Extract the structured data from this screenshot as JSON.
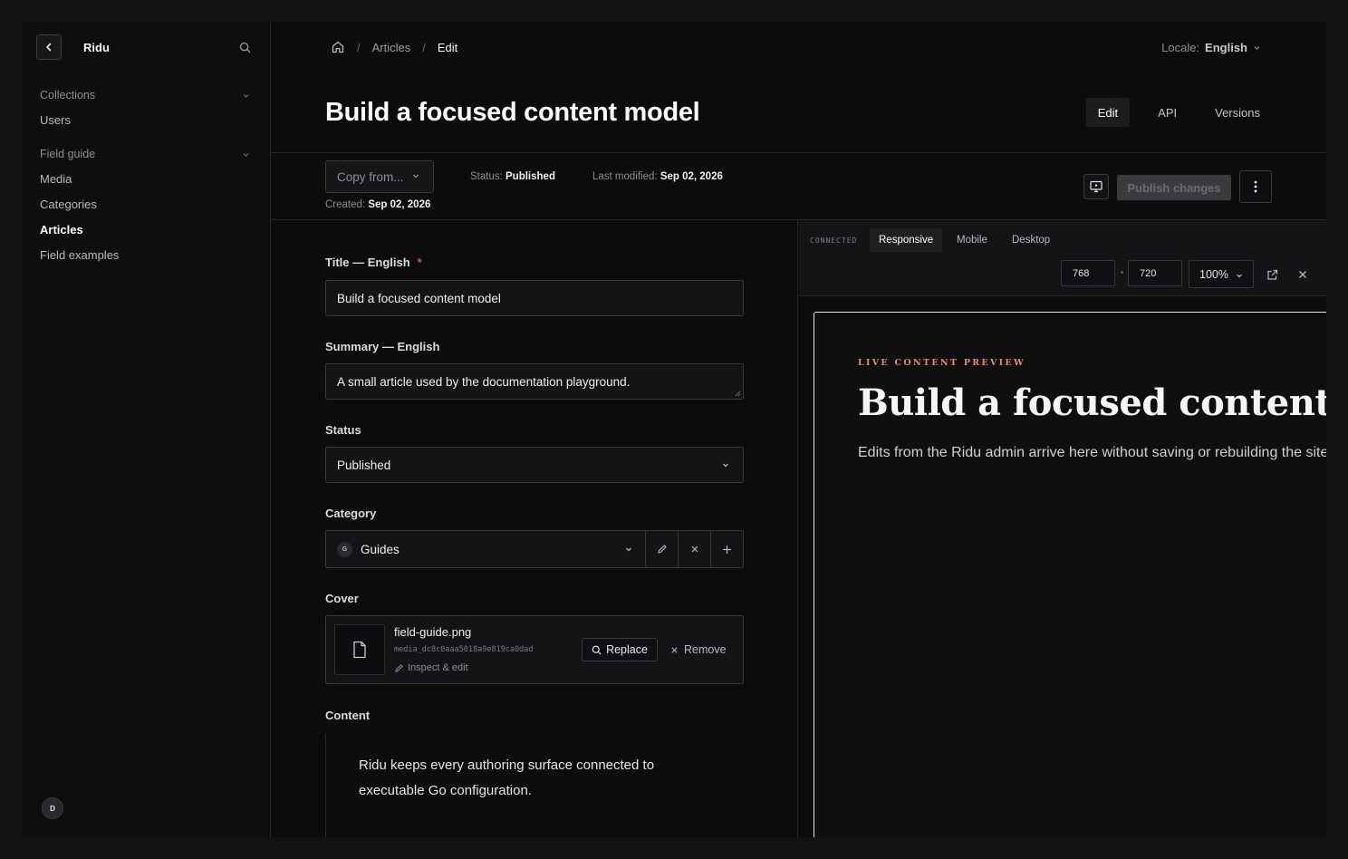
{
  "sidebar": {
    "brand": "Ridu",
    "groups": [
      {
        "label": "Collections",
        "items": [
          "Users"
        ]
      },
      {
        "label": "Field guide",
        "items": [
          "Media",
          "Categories",
          "Articles",
          "Field examples"
        ]
      }
    ],
    "active_item": "Articles",
    "avatar_initial": "D"
  },
  "breadcrumb": {
    "items": [
      "Articles",
      "Edit"
    ]
  },
  "locale": {
    "label": "Locale:",
    "value": "English"
  },
  "page": {
    "title": "Build a focused content model"
  },
  "tabs": [
    "Edit",
    "API",
    "Versions"
  ],
  "meta": {
    "copy_from_placeholder": "Copy from...",
    "status_label": "Status:",
    "status_value": "Published",
    "last_modified_label": "Last modified:",
    "last_modified_value": "Sep 02, 2026",
    "created_label": "Created:",
    "created_value": "Sep 02, 2026",
    "publish_label": "Publish changes"
  },
  "form": {
    "title_label": "Title — English",
    "title_required": "*",
    "title_value": "Build a focused content model",
    "summary_label": "Summary — English",
    "summary_value": "A small article used by the documentation playground.",
    "status_label": "Status",
    "status_value": "Published",
    "category_label": "Category",
    "category_badge": "G",
    "category_value": "Guides",
    "cover_label": "Cover",
    "cover_file_name": "field-guide.png",
    "cover_file_id": "media_dc8c0aaa5018a9e819ca0dad",
    "cover_inspect": "Inspect & edit",
    "cover_replace": "Replace",
    "cover_remove": "Remove",
    "content_label": "Content",
    "content_text": "Ridu keeps every authoring surface connected to executable Go configuration."
  },
  "preview": {
    "status": "CONNECTED",
    "modes": [
      "Responsive",
      "Mobile",
      "Desktop"
    ],
    "active_mode": "Responsive",
    "width": "768",
    "height": "720",
    "zoom": "100%",
    "kicker": "LIVE CONTENT PREVIEW",
    "title": "Build a focused content model",
    "subtitle": "Edits from the Ridu admin arrive here without saving or rebuilding the site."
  },
  "colors": {
    "accent_required": "#e5534b",
    "kicker": "#e08e78",
    "background": "#0c0c0d"
  },
  "icons": [
    "chevron-left-icon",
    "search-icon",
    "chevron-down-icon",
    "home-icon",
    "monitor-icon",
    "more-vertical-icon",
    "pencil-icon",
    "close-icon",
    "plus-icon",
    "file-icon",
    "external-link-icon"
  ]
}
